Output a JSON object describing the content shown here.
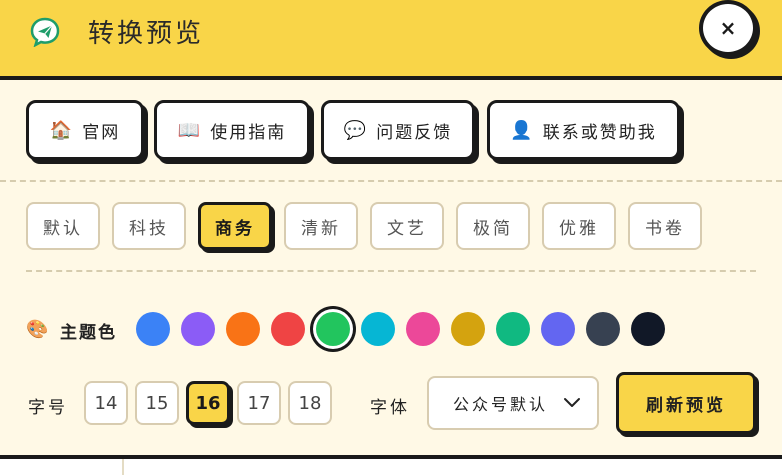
{
  "header": {
    "title": "转换预览",
    "close_label": "×"
  },
  "links": [
    {
      "icon": "🏠",
      "label": "官网"
    },
    {
      "icon": "📖",
      "label": "使用指南"
    },
    {
      "icon": "💬",
      "label": "问题反馈"
    },
    {
      "icon": "👤",
      "label": "联系或赞助我"
    }
  ],
  "themes": [
    "默认",
    "科技",
    "商务",
    "清新",
    "文艺",
    "极简",
    "优雅",
    "书卷"
  ],
  "selected_theme": "商务",
  "theme_color": {
    "icon": "🎨",
    "label": "主题色",
    "swatches": [
      "#3b82f6",
      "#8b5cf6",
      "#f97316",
      "#ef4444",
      "#22c55e",
      "#06b6d4",
      "#ec4899",
      "#d4a30f",
      "#10b981",
      "#6366f1",
      "#374151",
      "#111827"
    ],
    "selected_index": 4
  },
  "font_size": {
    "label": "字号",
    "options": [
      "14",
      "15",
      "16",
      "17",
      "18"
    ],
    "selected": "16"
  },
  "font_family": {
    "label": "字体",
    "selected": "公众号默认"
  },
  "refresh_label": "刷新预览",
  "colors": {
    "accent": "#f9d548",
    "border": "#1a1a1a",
    "background": "#fff9e6"
  }
}
